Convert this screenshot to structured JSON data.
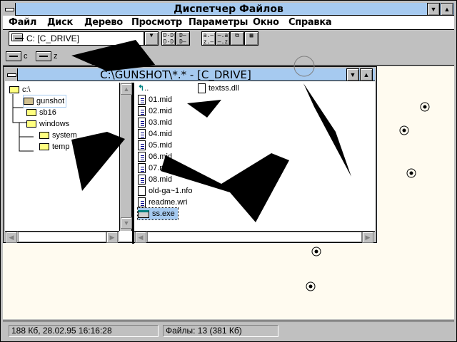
{
  "window": {
    "title": "Диспетчер Файлов"
  },
  "menu": [
    "Файл",
    "Диск",
    "Дерево",
    "Просмотр",
    "Параметры",
    "Окно",
    "Справка"
  ],
  "toolbar": {
    "drive_selected": "C: [C_DRIVE]"
  },
  "drives": [
    "c",
    "z"
  ],
  "child": {
    "title": "C:\\GUNSHOT\\*.* - [C_DRIVE]"
  },
  "tree": [
    "c:\\",
    "gunshot",
    "sb16",
    "windows",
    "system",
    "temp"
  ],
  "files": {
    "up": "..",
    "col1": [
      "01.mid",
      "02.mid",
      "03.mid",
      "04.mid",
      "05.mid",
      "06.mid",
      "07.mid",
      "08.mid",
      "old-ga~1.nfo",
      "readme.wri",
      "ss.exe"
    ],
    "col2": [
      "textss.dll"
    ],
    "selected": "ss.exe"
  },
  "status": {
    "left": "188 Кб, 28.02.95 16:16:28",
    "right": "Файлы: 13 (381 Кб)"
  }
}
